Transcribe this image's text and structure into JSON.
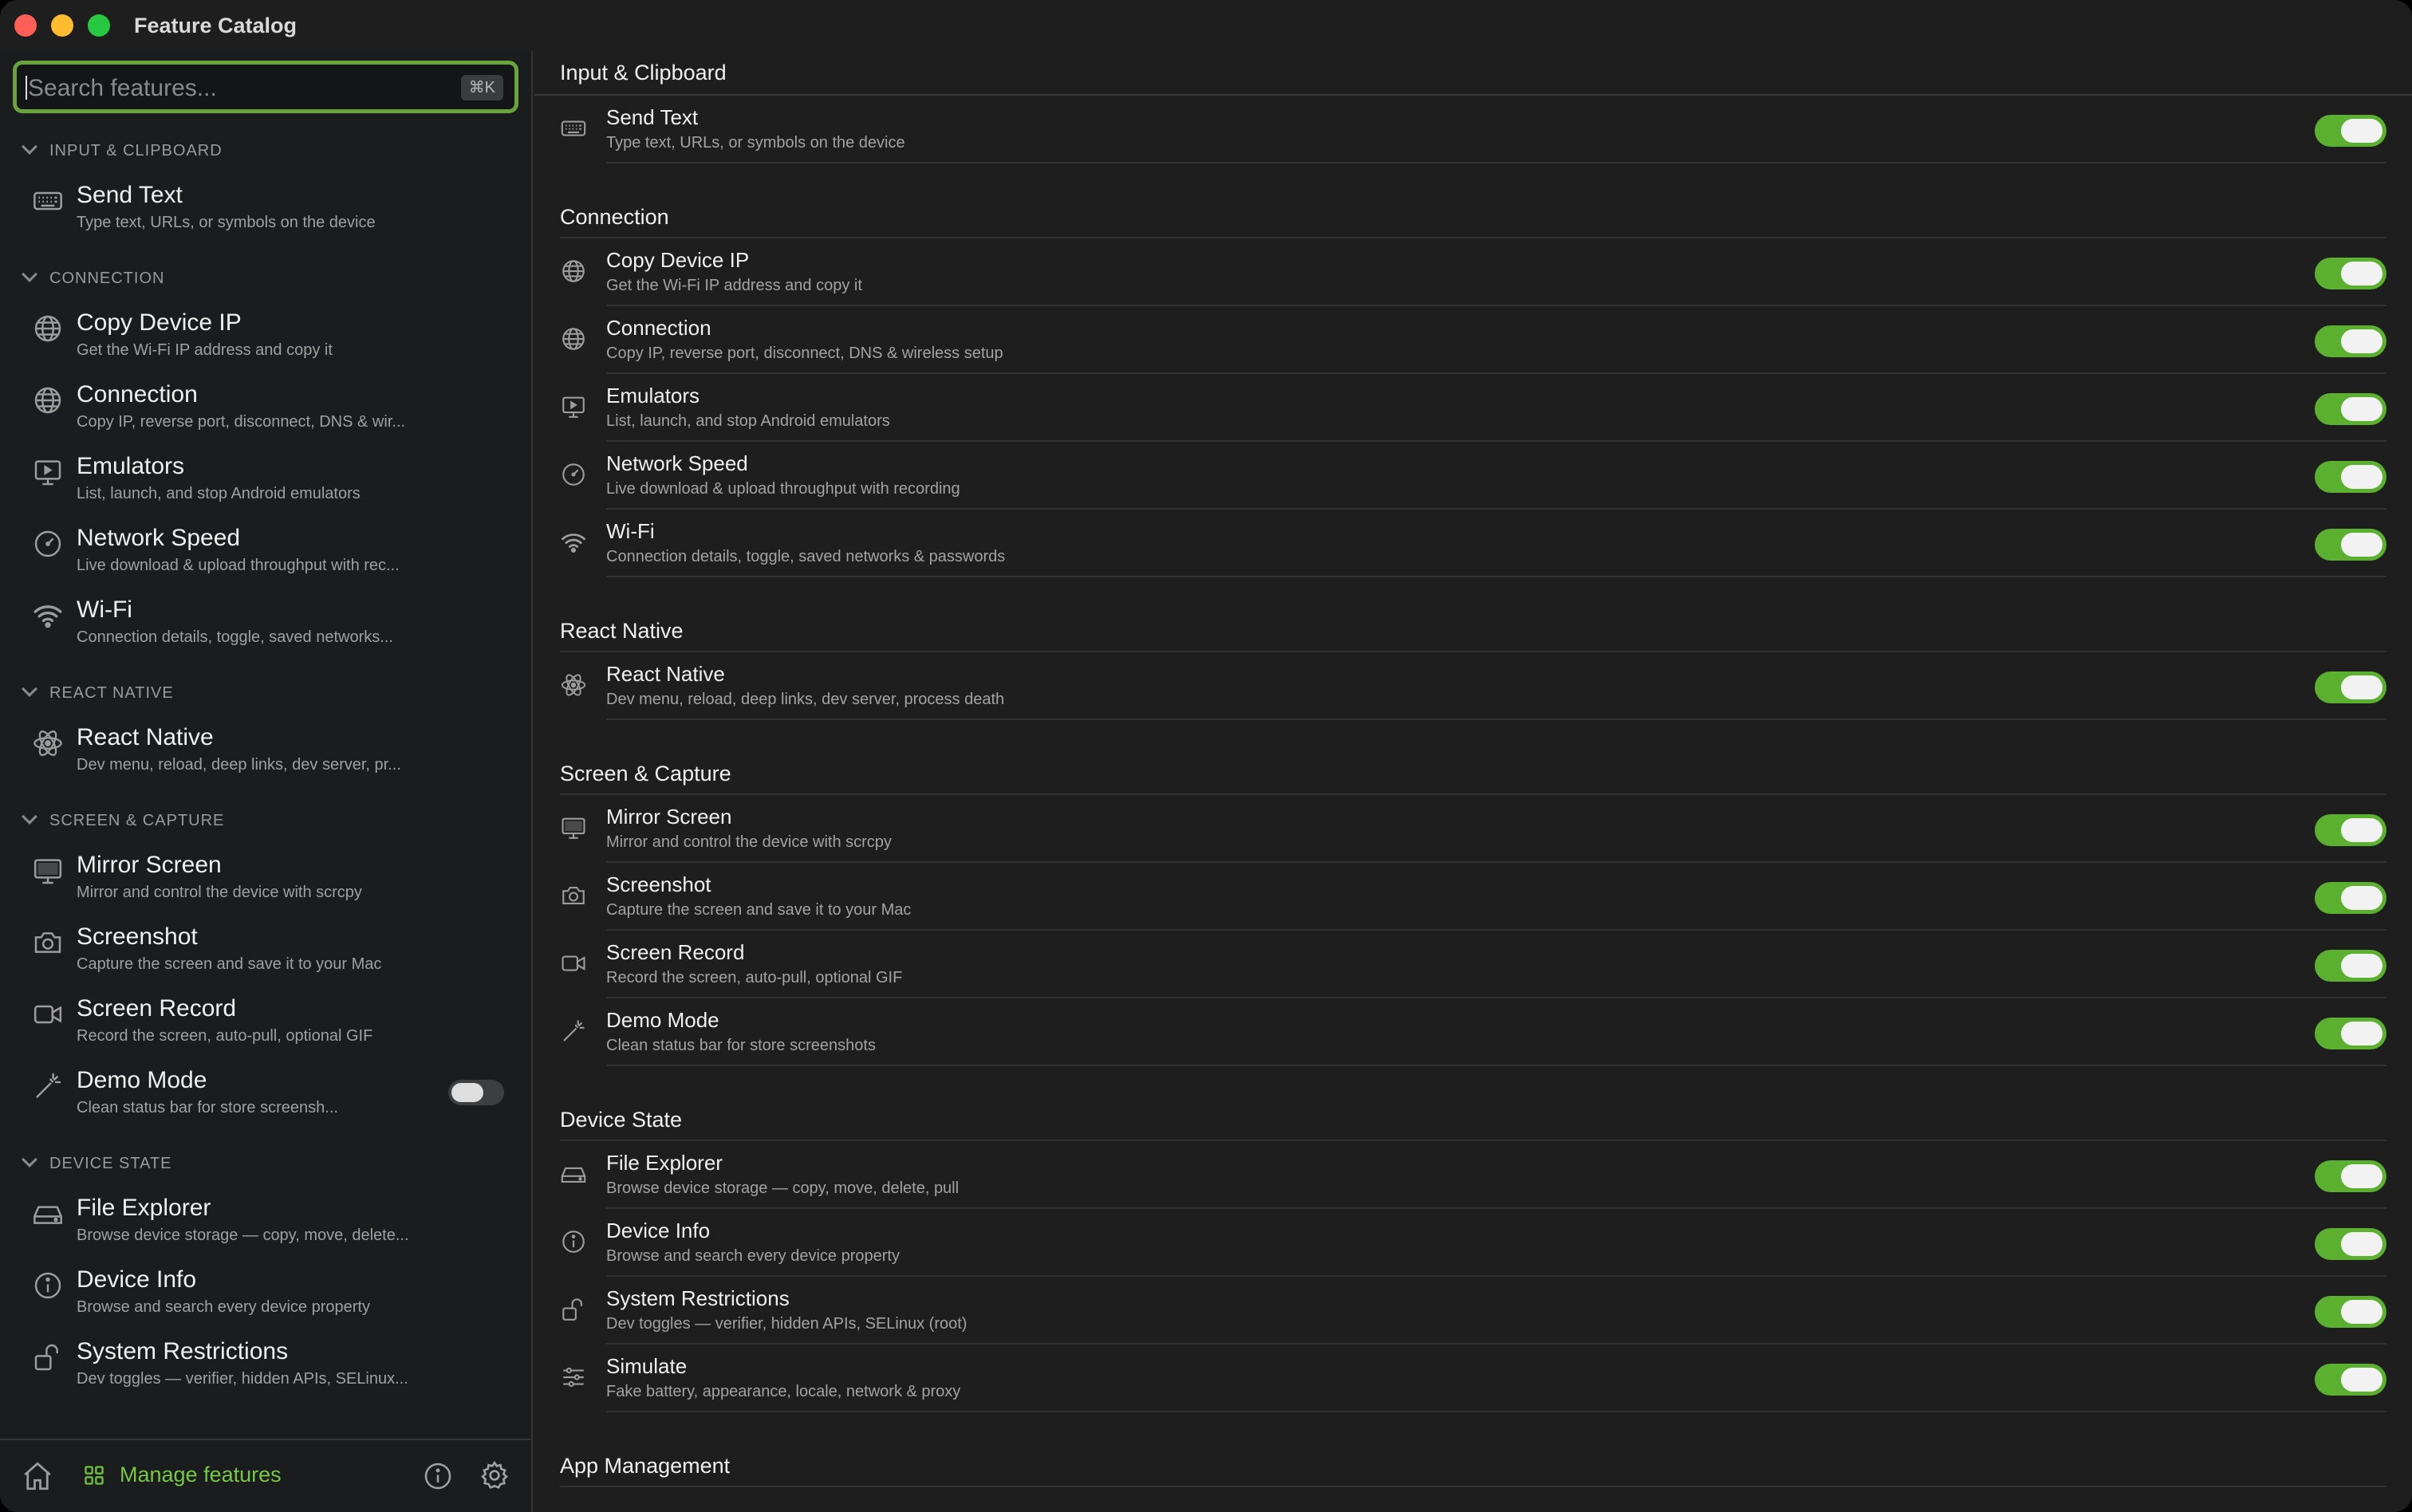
{
  "window": {
    "title": "Feature Catalog"
  },
  "search": {
    "placeholder": "Search features...",
    "shortcut": "⌘K"
  },
  "sidebar": {
    "sections": [
      {
        "label": "INPUT & CLIPBOARD",
        "items": [
          {
            "icon": "keyboard-icon",
            "title": "Send Text",
            "desc": "Type text, URLs, or symbols on the device"
          }
        ]
      },
      {
        "label": "CONNECTION",
        "items": [
          {
            "icon": "globe-icon",
            "title": "Copy Device IP",
            "desc": "Get the Wi-Fi IP address and copy it"
          },
          {
            "icon": "globe-icon",
            "title": "Connection",
            "desc": "Copy IP, reverse port, disconnect, DNS & wir..."
          },
          {
            "icon": "emulator-icon",
            "title": "Emulators",
            "desc": "List, launch, and stop Android emulators"
          },
          {
            "icon": "speedometer-icon",
            "title": "Network Speed",
            "desc": "Live download & upload throughput with rec..."
          },
          {
            "icon": "wifi-icon",
            "title": "Wi-Fi",
            "desc": "Connection details, toggle, saved networks..."
          }
        ]
      },
      {
        "label": "REACT NATIVE",
        "items": [
          {
            "icon": "atom-icon",
            "title": "React Native",
            "desc": "Dev menu, reload, deep links, dev server, pr..."
          }
        ]
      },
      {
        "label": "SCREEN & CAPTURE",
        "items": [
          {
            "icon": "monitor-icon",
            "title": "Mirror Screen",
            "desc": "Mirror and control the device with scrcpy"
          },
          {
            "icon": "camera-icon",
            "title": "Screenshot",
            "desc": "Capture the screen and save it to your Mac"
          },
          {
            "icon": "video-icon",
            "title": "Screen Record",
            "desc": "Record the screen, auto-pull, optional GIF"
          },
          {
            "icon": "wand-icon",
            "title": "Demo Mode",
            "desc": "Clean status bar for store screensh...",
            "toggle": false
          }
        ]
      },
      {
        "label": "DEVICE STATE",
        "items": [
          {
            "icon": "drive-icon",
            "title": "File Explorer",
            "desc": "Browse device storage — copy, move, delete..."
          },
          {
            "icon": "info-icon",
            "title": "Device Info",
            "desc": "Browse and search every device property"
          },
          {
            "icon": "unlock-icon",
            "title": "System Restrictions",
            "desc": "Dev toggles — verifier, hidden APIs, SELinux..."
          }
        ]
      }
    ]
  },
  "footer": {
    "manage_label": "Manage features"
  },
  "main": {
    "sections": [
      {
        "label": "Input & Clipboard",
        "items": [
          {
            "icon": "keyboard-icon",
            "title": "Send Text",
            "desc": "Type text, URLs, or symbols on the device",
            "enabled": true
          }
        ]
      },
      {
        "label": "Connection",
        "items": [
          {
            "icon": "globe-icon",
            "title": "Copy Device IP",
            "desc": "Get the Wi-Fi IP address and copy it",
            "enabled": true
          },
          {
            "icon": "globe-icon",
            "title": "Connection",
            "desc": "Copy IP, reverse port, disconnect, DNS & wireless setup",
            "enabled": true
          },
          {
            "icon": "emulator-icon",
            "title": "Emulators",
            "desc": "List, launch, and stop Android emulators",
            "enabled": true
          },
          {
            "icon": "speedometer-icon",
            "title": "Network Speed",
            "desc": "Live download & upload throughput with recording",
            "enabled": true
          },
          {
            "icon": "wifi-icon",
            "title": "Wi-Fi",
            "desc": "Connection details, toggle, saved networks & passwords",
            "enabled": true
          }
        ]
      },
      {
        "label": "React Native",
        "items": [
          {
            "icon": "atom-icon",
            "title": "React Native",
            "desc": "Dev menu, reload, deep links, dev server, process death",
            "enabled": true
          }
        ]
      },
      {
        "label": "Screen & Capture",
        "items": [
          {
            "icon": "monitor-icon",
            "title": "Mirror Screen",
            "desc": "Mirror and control the device with scrcpy",
            "enabled": true
          },
          {
            "icon": "camera-icon",
            "title": "Screenshot",
            "desc": "Capture the screen and save it to your Mac",
            "enabled": true
          },
          {
            "icon": "video-icon",
            "title": "Screen Record",
            "desc": "Record the screen, auto-pull, optional GIF",
            "enabled": true
          },
          {
            "icon": "wand-icon",
            "title": "Demo Mode",
            "desc": "Clean status bar for store screenshots",
            "enabled": true
          }
        ]
      },
      {
        "label": "Device State",
        "items": [
          {
            "icon": "drive-icon",
            "title": "File Explorer",
            "desc": "Browse device storage — copy, move, delete, pull",
            "enabled": true
          },
          {
            "icon": "info-icon",
            "title": "Device Info",
            "desc": "Browse and search every device property",
            "enabled": true
          },
          {
            "icon": "unlock-icon",
            "title": "System Restrictions",
            "desc": "Dev toggles — verifier, hidden APIs, SELinux (root)",
            "enabled": true
          },
          {
            "icon": "sliders-icon",
            "title": "Simulate",
            "desc": "Fake battery, appearance, locale, network & proxy",
            "enabled": true
          }
        ]
      },
      {
        "label": "App Management",
        "items": []
      }
    ]
  },
  "colors": {
    "accent": "#6aa33c",
    "toggle_on": "#5bb030",
    "background": "#1e1e1e",
    "sidebar": "#1b1c1e"
  }
}
